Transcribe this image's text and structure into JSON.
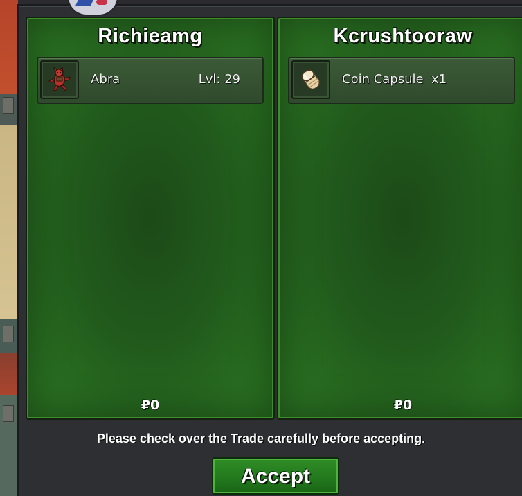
{
  "trade": {
    "left": {
      "player_name": "Richieamg",
      "item": {
        "icon": "abra-sprite-icon",
        "name": "Abra",
        "level": "Lvl: 29"
      },
      "money": "₽0"
    },
    "right": {
      "player_name": "Kcrushtooraw",
      "item": {
        "icon": "coin-capsule-icon",
        "name": "Coin Capsule  x1"
      },
      "money": "₽0"
    },
    "notice": "Please check over the Trade carefully before accepting.",
    "accept_label": "Accept"
  },
  "colors": {
    "panel_green": "#2d7a24",
    "button_green": "#2f8c26",
    "window_bg": "#2e2f33"
  }
}
